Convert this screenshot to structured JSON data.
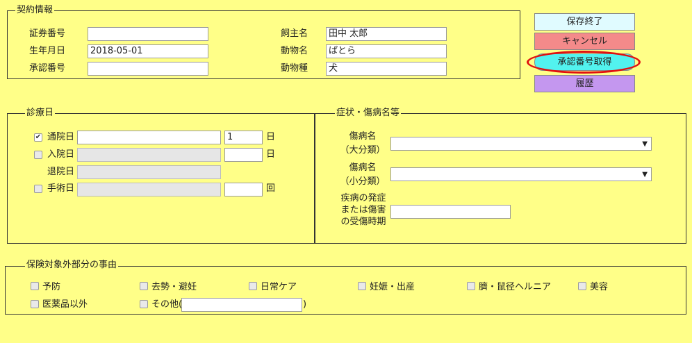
{
  "contract": {
    "legend": "契約情報",
    "securities_label": "証券番号",
    "securities_value": "",
    "birth_label": "生年月日",
    "birth_value": "2018-05-01",
    "approval_label": "承認番号",
    "approval_value": "",
    "owner_label": "飼主名",
    "owner_value": "田中 太郎",
    "animal_name_label": "動物名",
    "animal_name_value": "ぱとら",
    "animal_type_label": "動物種",
    "animal_type_value": "犬"
  },
  "buttons": {
    "save": "保存終了",
    "cancel": "キャンセル",
    "approval": "承認番号取得",
    "history": "履歴"
  },
  "colors": {
    "background": "#ffff88",
    "save_button": "#e0fbff",
    "cancel_button": "#f48a8a",
    "approval_button": "#52f2ef",
    "history_button": "#c497ef",
    "highlight_ring": "#e01010"
  },
  "treatment": {
    "legend": "診療日",
    "outpatient_label": "通院日",
    "outpatient_checked": true,
    "outpatient_dates": "",
    "outpatient_count": "1",
    "outpatient_unit": "日",
    "admission_label": "入院日",
    "admission_checked": false,
    "admission_dates": "",
    "admission_count": "",
    "admission_unit": "日",
    "discharge_label": "退院日",
    "discharge_dates": "",
    "surgery_label": "手術日",
    "surgery_checked": false,
    "surgery_dates": "",
    "surgery_count": "",
    "surgery_unit": "回"
  },
  "symptoms": {
    "legend": "症状・傷病名等",
    "major_label_1": "傷病名",
    "major_label_2": "（大分類）",
    "major_value": "",
    "minor_label_1": "傷病名",
    "minor_label_2": "（小分類）",
    "minor_value": "",
    "onset_label_1": "疾病の発症",
    "onset_label_2": "または傷害",
    "onset_label_3": "の受傷時期",
    "onset_value": ""
  },
  "exclusion": {
    "legend": "保険対象外部分の事由",
    "items": [
      "予防",
      "去勢・避妊",
      "日常ケア",
      "妊娠・出産",
      "臍・鼠径ヘルニア",
      "美容",
      "医薬品以外"
    ],
    "other_label": "その他(",
    "other_value": "",
    "other_close": ")"
  },
  "icons": {
    "checkmark": "check-icon",
    "dropdown": "chevron-down-icon"
  }
}
